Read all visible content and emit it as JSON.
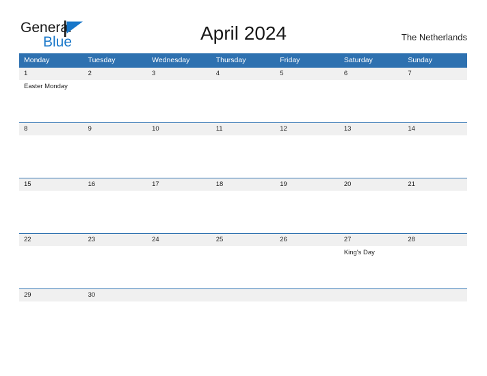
{
  "brand": {
    "name_part1": "General",
    "name_part2": "Blue",
    "flag_icon": "blue-flag-triangle-icon",
    "color_dark": "#1a1a1a",
    "color_blue": "#1877c9"
  },
  "header": {
    "title": "April 2024",
    "country": "The Netherlands"
  },
  "theme": {
    "header_blue": "#2e71b0",
    "date_band_gray": "#f0f0f0",
    "text_dark": "#1f1f1f",
    "header_text": "#ffffff"
  },
  "calendar": {
    "weekday_headers": [
      "Monday",
      "Tuesday",
      "Wednesday",
      "Thursday",
      "Friday",
      "Saturday",
      "Sunday"
    ],
    "weeks": [
      {
        "days": [
          {
            "date": "1",
            "events": [
              "Easter Monday"
            ]
          },
          {
            "date": "2",
            "events": []
          },
          {
            "date": "3",
            "events": []
          },
          {
            "date": "4",
            "events": []
          },
          {
            "date": "5",
            "events": []
          },
          {
            "date": "6",
            "events": []
          },
          {
            "date": "7",
            "events": []
          }
        ]
      },
      {
        "days": [
          {
            "date": "8",
            "events": []
          },
          {
            "date": "9",
            "events": []
          },
          {
            "date": "10",
            "events": []
          },
          {
            "date": "11",
            "events": []
          },
          {
            "date": "12",
            "events": []
          },
          {
            "date": "13",
            "events": []
          },
          {
            "date": "14",
            "events": []
          }
        ]
      },
      {
        "days": [
          {
            "date": "15",
            "events": []
          },
          {
            "date": "16",
            "events": []
          },
          {
            "date": "17",
            "events": []
          },
          {
            "date": "18",
            "events": []
          },
          {
            "date": "19",
            "events": []
          },
          {
            "date": "20",
            "events": []
          },
          {
            "date": "21",
            "events": []
          }
        ]
      },
      {
        "days": [
          {
            "date": "22",
            "events": []
          },
          {
            "date": "23",
            "events": []
          },
          {
            "date": "24",
            "events": []
          },
          {
            "date": "25",
            "events": []
          },
          {
            "date": "26",
            "events": []
          },
          {
            "date": "27",
            "events": [
              "King's Day"
            ]
          },
          {
            "date": "28",
            "events": []
          }
        ]
      },
      {
        "days": [
          {
            "date": "29",
            "events": []
          },
          {
            "date": "30",
            "events": []
          },
          {
            "date": "",
            "events": []
          },
          {
            "date": "",
            "events": []
          },
          {
            "date": "",
            "events": []
          },
          {
            "date": "",
            "events": []
          },
          {
            "date": "",
            "events": []
          }
        ]
      }
    ]
  }
}
